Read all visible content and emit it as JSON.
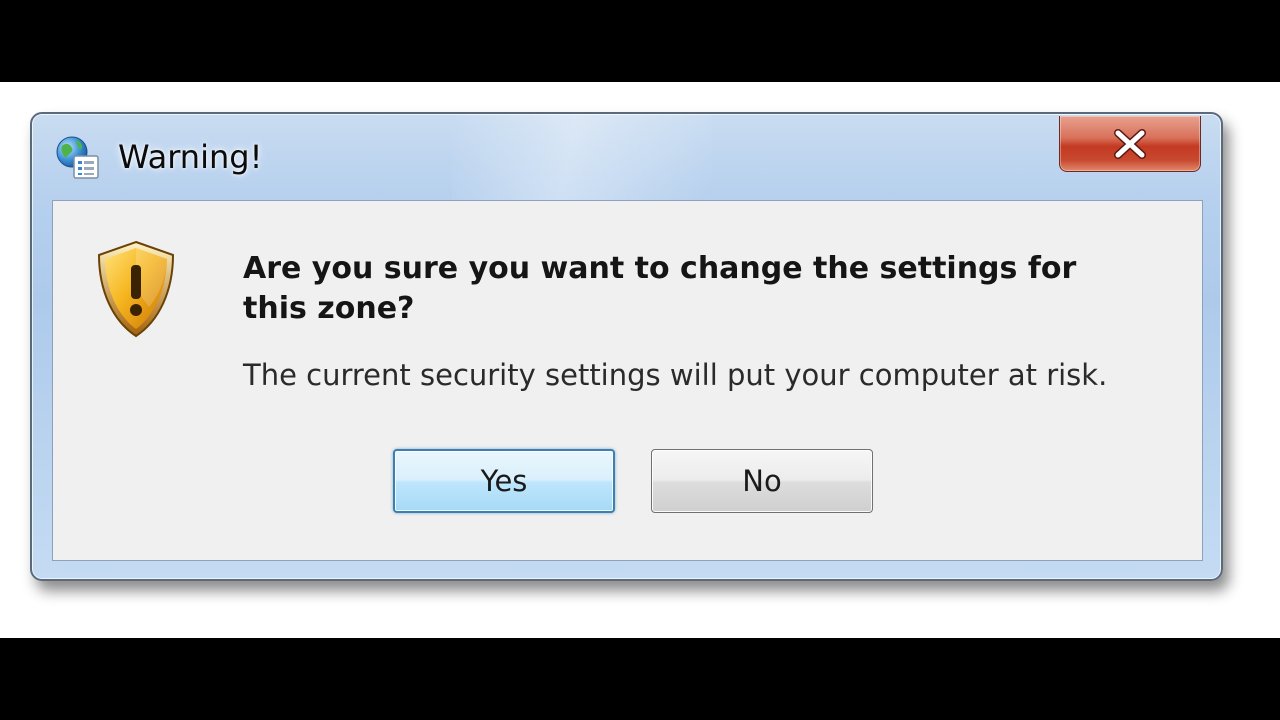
{
  "window": {
    "title": "Warning!",
    "app_icon": "internet-options-icon",
    "close_icon": "close-icon"
  },
  "dialog": {
    "icon": "security-shield-warning-icon",
    "main_instruction": "Are you sure you want to change the settings for this zone?",
    "content": "The current security settings will put your computer at risk."
  },
  "buttons": {
    "yes_label": "Yes",
    "no_label": "No",
    "default": "Yes"
  },
  "colors": {
    "shield_gold": "#f2a516",
    "close_red": "#c43a22",
    "default_button_border": "#3c7fb1"
  }
}
